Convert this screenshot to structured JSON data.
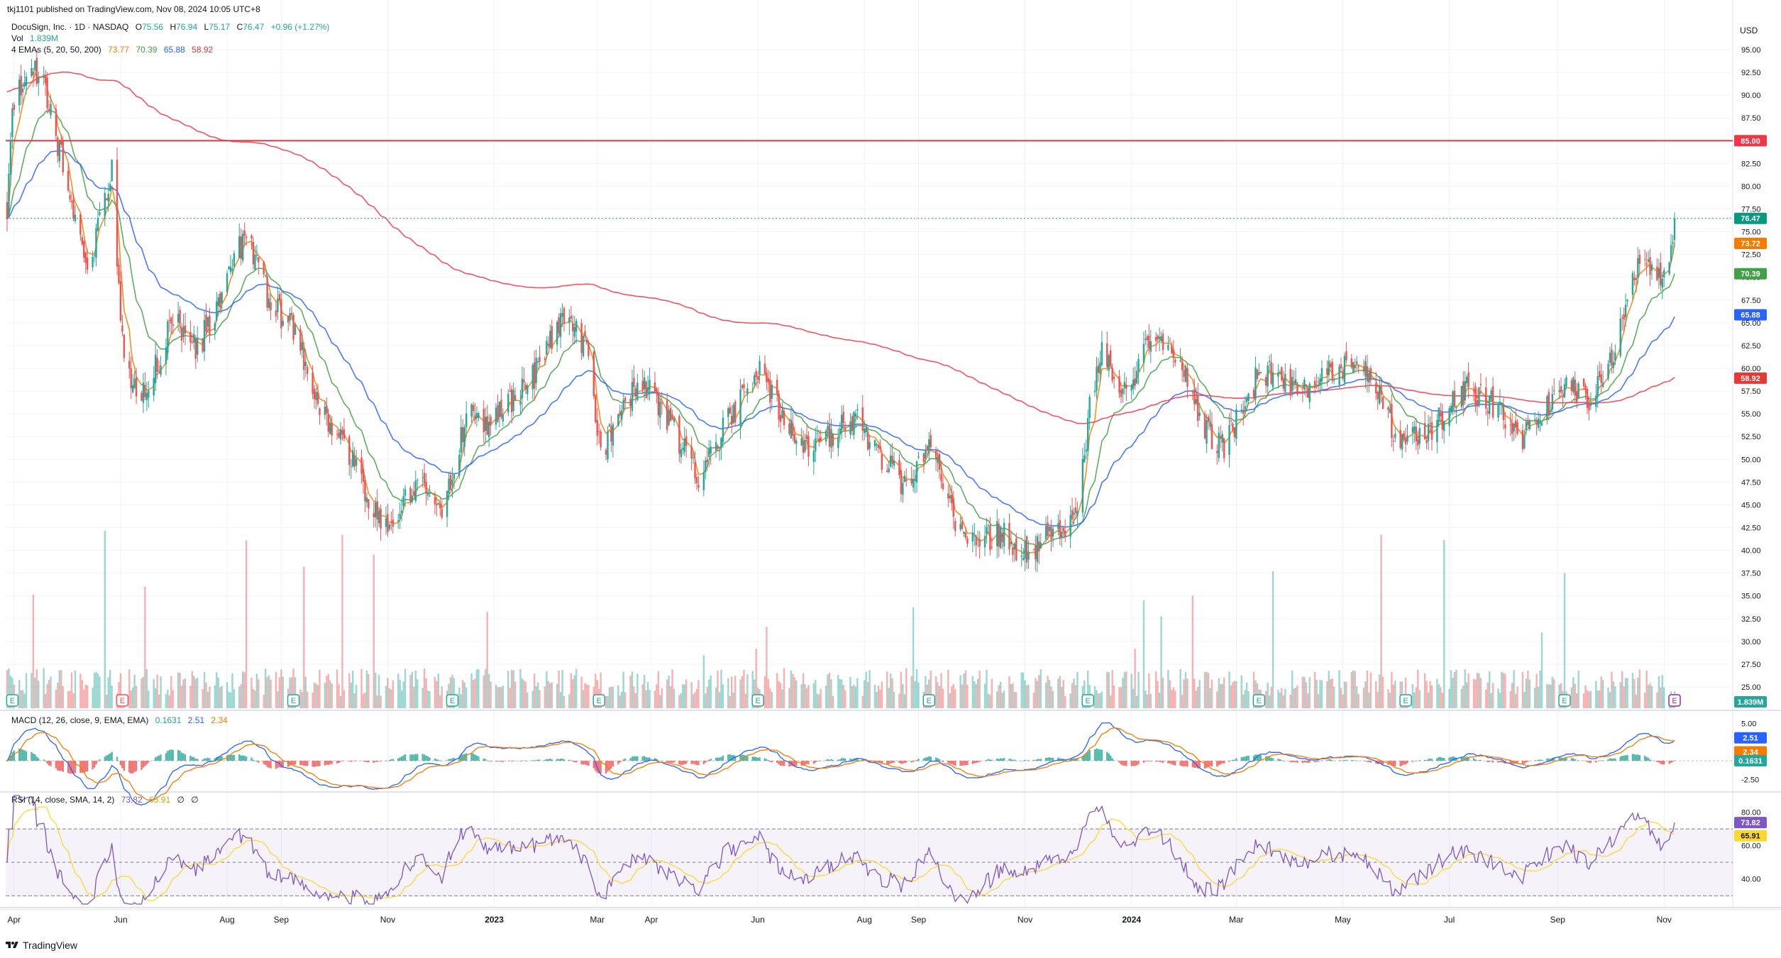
{
  "header": {
    "publish_text": "tkj1101 published on TradingView.com, Nov 08, 2024 10:05 UTC+8"
  },
  "legend": {
    "symbol": "DocuSign, Inc. · 1D · NASDAQ",
    "o_label": "O",
    "o_value": "75.56",
    "h_label": "H",
    "h_value": "76.94",
    "l_label": "L",
    "l_value": "75.17",
    "c_label": "C",
    "c_value": "76.47",
    "change": "+0.96 (+1.27%)",
    "vol_label": "Vol",
    "vol_value": "1.839M",
    "ema_label": "4 EMAs (5, 20, 50, 200)",
    "ema_values": [
      "73.77",
      "70.39",
      "65.88",
      "58.92"
    ]
  },
  "macd_legend": {
    "label": "MACD (12, 26, close, 9, EMA, EMA)",
    "values": [
      "0.1631",
      "2.51",
      "2.34"
    ]
  },
  "rsi_legend": {
    "label": "RSI (14, close, SMA, 14, 2)",
    "values": [
      "73.82",
      "65.91",
      "∅",
      "∅"
    ]
  },
  "price_axis": {
    "currency": "USD",
    "ticks": [
      "95.00",
      "92.50",
      "90.00",
      "87.50",
      "85.00",
      "82.50",
      "80.00",
      "77.50",
      "75.00",
      "72.50",
      "70.00",
      "67.50",
      "65.00",
      "62.50",
      "60.00",
      "57.50",
      "55.00",
      "52.50",
      "50.00",
      "47.50",
      "45.00",
      "42.50",
      "40.00",
      "37.50",
      "35.00",
      "32.50",
      "30.00",
      "27.50",
      "25.00"
    ],
    "badges": [
      {
        "text": "85.00",
        "color": "#f23645",
        "value": 85
      },
      {
        "text": "76.47",
        "color": "#089981",
        "value": 76.47
      },
      {
        "text": "73.72",
        "color": "#f57c00",
        "value": 73.72
      },
      {
        "text": "70.39",
        "color": "#43a047",
        "value": 70.39
      },
      {
        "text": "65.88",
        "color": "#2962ff",
        "value": 65.88
      },
      {
        "text": "58.92",
        "color": "#e53935",
        "value": 58.92
      }
    ],
    "volume_badge": {
      "text": "1.839M",
      "color": "#26a69a"
    }
  },
  "macd_axis": {
    "ticks": [
      "5.00",
      "-2.50"
    ],
    "badges": [
      {
        "text": "2.51",
        "color": "#2962ff"
      },
      {
        "text": "2.34",
        "color": "#f57c00"
      },
      {
        "text": "0.1631",
        "color": "#26a69a"
      }
    ]
  },
  "rsi_axis": {
    "ticks": [
      "80.00",
      "60.00",
      "40.00"
    ],
    "badges": [
      {
        "text": "73.82",
        "color": "#7e57c2"
      },
      {
        "text": "65.91",
        "color": "#fdd835"
      }
    ]
  },
  "time_axis": {
    "labels": [
      "Apr",
      "Jun",
      "Aug",
      "Sep",
      "Nov",
      "2023",
      "Mar",
      "Apr",
      "Jun",
      "Aug",
      "Sep",
      "Nov",
      "2024",
      "Mar",
      "May",
      "Jul",
      "Sep",
      "Nov"
    ]
  },
  "brand": {
    "text": "TradingView",
    "icon": "tradingview-logo"
  },
  "colors": {
    "up": "#26a69a",
    "down": "#ef5350",
    "ema5": "#f57c00",
    "ema20": "#43a047",
    "ema50": "#2962ff",
    "ema200": "#f23645",
    "macd": "#2962ff",
    "signal": "#f57c00",
    "rsi": "#7e57c2",
    "rsi_ma": "#fdd835"
  },
  "chart_data": {
    "type": "candlestick",
    "symbol": "DocuSign, Inc.",
    "interval": "1D",
    "ylim": [
      25,
      97.5
    ],
    "horizontal_level": 85.0,
    "last_close": 76.47,
    "close_path": [
      {
        "t": "2022-03-28",
        "close": 78
      },
      {
        "t": "2022-04-01",
        "close": 90
      },
      {
        "t": "2022-04-15",
        "close": 93
      },
      {
        "t": "2022-04-28",
        "close": 83
      },
      {
        "t": "2022-05-13",
        "close": 70
      },
      {
        "t": "2022-05-27",
        "close": 82
      },
      {
        "t": "2022-06-03",
        "close": 60
      },
      {
        "t": "2022-06-16",
        "close": 57
      },
      {
        "t": "2022-07-01",
        "close": 66
      },
      {
        "t": "2022-07-15",
        "close": 62
      },
      {
        "t": "2022-07-29",
        "close": 68
      },
      {
        "t": "2022-08-12",
        "close": 75
      },
      {
        "t": "2022-08-26",
        "close": 67
      },
      {
        "t": "2022-09-09",
        "close": 64
      },
      {
        "t": "2022-09-23",
        "close": 55
      },
      {
        "t": "2022-10-07",
        "close": 52
      },
      {
        "t": "2022-10-21",
        "close": 46
      },
      {
        "t": "2022-11-01",
        "close": 42
      },
      {
        "t": "2022-11-18",
        "close": 48
      },
      {
        "t": "2022-12-02",
        "close": 44
      },
      {
        "t": "2022-12-16",
        "close": 55
      },
      {
        "t": "2022-12-30",
        "close": 54
      },
      {
        "t": "2023-01-13",
        "close": 57
      },
      {
        "t": "2023-01-27",
        "close": 60
      },
      {
        "t": "2023-02-10",
        "close": 66
      },
      {
        "t": "2023-02-24",
        "close": 62
      },
      {
        "t": "2023-03-03",
        "close": 50
      },
      {
        "t": "2023-03-17",
        "close": 57
      },
      {
        "t": "2023-03-31",
        "close": 58
      },
      {
        "t": "2023-04-14",
        "close": 53
      },
      {
        "t": "2023-04-28",
        "close": 48
      },
      {
        "t": "2023-05-12",
        "close": 53
      },
      {
        "t": "2023-05-26",
        "close": 58
      },
      {
        "t": "2023-06-02",
        "close": 60
      },
      {
        "t": "2023-06-16",
        "close": 54
      },
      {
        "t": "2023-06-30",
        "close": 51
      },
      {
        "t": "2023-07-14",
        "close": 53
      },
      {
        "t": "2023-07-28",
        "close": 54
      },
      {
        "t": "2023-08-11",
        "close": 50
      },
      {
        "t": "2023-08-25",
        "close": 47
      },
      {
        "t": "2023-09-08",
        "close": 52
      },
      {
        "t": "2023-09-22",
        "close": 43
      },
      {
        "t": "2023-10-06",
        "close": 41
      },
      {
        "t": "2023-10-20",
        "close": 42
      },
      {
        "t": "2023-11-03",
        "close": 39
      },
      {
        "t": "2023-11-17",
        "close": 42
      },
      {
        "t": "2023-12-01",
        "close": 44
      },
      {
        "t": "2023-12-08",
        "close": 56
      },
      {
        "t": "2023-12-15",
        "close": 62
      },
      {
        "t": "2023-12-29",
        "close": 57
      },
      {
        "t": "2024-01-12",
        "close": 63
      },
      {
        "t": "2024-01-26",
        "close": 62
      },
      {
        "t": "2024-02-09",
        "close": 54
      },
      {
        "t": "2024-02-23",
        "close": 51
      },
      {
        "t": "2024-03-08",
        "close": 58
      },
      {
        "t": "2024-03-22",
        "close": 60
      },
      {
        "t": "2024-04-05",
        "close": 57
      },
      {
        "t": "2024-04-19",
        "close": 59
      },
      {
        "t": "2024-05-03",
        "close": 60
      },
      {
        "t": "2024-05-17",
        "close": 59
      },
      {
        "t": "2024-05-31",
        "close": 53
      },
      {
        "t": "2024-06-14",
        "close": 52
      },
      {
        "t": "2024-06-28",
        "close": 55
      },
      {
        "t": "2024-07-12",
        "close": 58
      },
      {
        "t": "2024-07-26",
        "close": 56
      },
      {
        "t": "2024-08-09",
        "close": 52
      },
      {
        "t": "2024-08-23",
        "close": 55
      },
      {
        "t": "2024-09-06",
        "close": 58
      },
      {
        "t": "2024-09-20",
        "close": 56
      },
      {
        "t": "2024-10-04",
        "close": 62
      },
      {
        "t": "2024-10-11",
        "close": 68
      },
      {
        "t": "2024-10-18",
        "close": 72
      },
      {
        "t": "2024-10-25",
        "close": 70
      },
      {
        "t": "2024-11-01",
        "close": 70
      },
      {
        "t": "2024-11-07",
        "close": 76.47
      }
    ],
    "last_values": {
      "ema5": 73.77,
      "ema20": 70.39,
      "ema50": 65.88,
      "ema200": 58.92,
      "volume": "1.839M",
      "macd": 2.51,
      "signal": 2.34,
      "histogram": 0.1631,
      "rsi": 73.82,
      "rsi_ma": 65.91
    },
    "macd_ylim": [
      -3.5,
      6
    ],
    "rsi_ylim": [
      25,
      90
    ],
    "rsi_bands": [
      30,
      50,
      70
    ],
    "earnings_markers": [
      "2022-03-31",
      "2022-06-02",
      "2022-09-08",
      "2022-12-08",
      "2023-03-02",
      "2023-06-01",
      "2023-09-07",
      "2023-12-07",
      "2024-03-14",
      "2024-06-06",
      "2024-09-05",
      "2024-11-07"
    ]
  }
}
